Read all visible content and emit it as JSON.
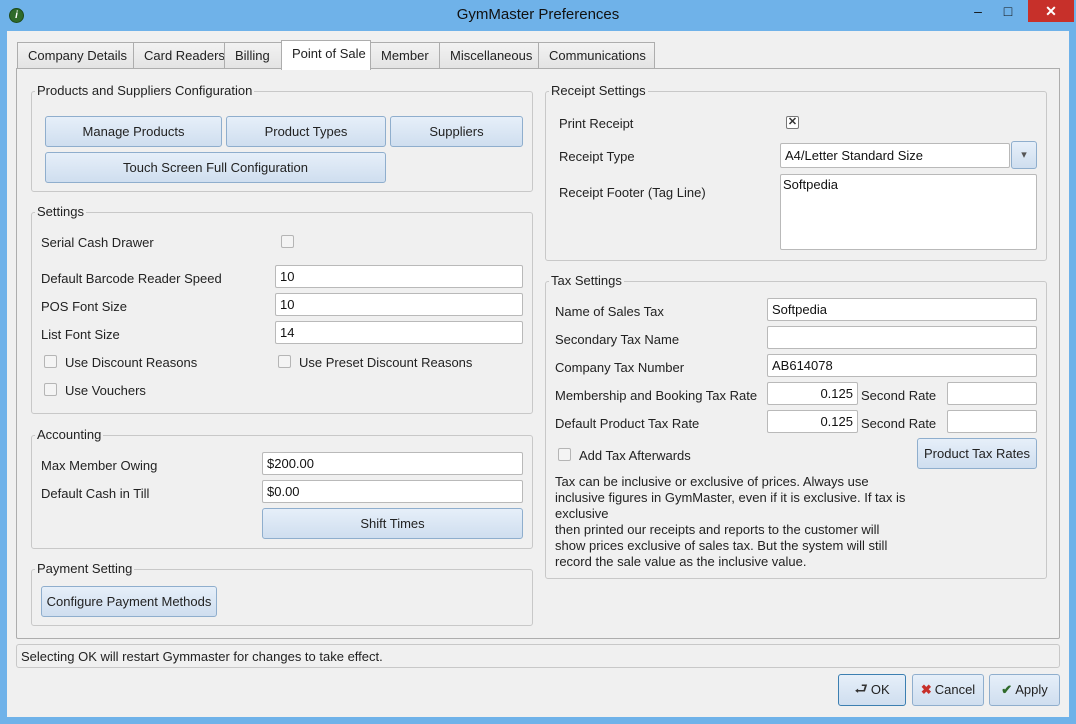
{
  "window": {
    "title": "GymMaster Preferences",
    "app_icon": "gymmaster-icon"
  },
  "window_controls": {
    "minimize": "–",
    "maximize": "□",
    "close": "✕"
  },
  "tabs": [
    {
      "label": "Company Details"
    },
    {
      "label": "Card Readers"
    },
    {
      "label": "Billing"
    },
    {
      "label": "Point of Sale"
    },
    {
      "label": "Member"
    },
    {
      "label": "Miscellaneous"
    },
    {
      "label": "Communications"
    }
  ],
  "active_tab": "Point of Sale",
  "products": {
    "legend": "Products and Suppliers Configuration",
    "manage_products": "Manage Products",
    "product_types": "Product Types",
    "suppliers": "Suppliers",
    "touch_screen": "Touch Screen Full Configuration"
  },
  "settings": {
    "legend": "Settings",
    "serial_cash_drawer": {
      "label": "Serial Cash Drawer",
      "checked": false
    },
    "barcode_speed": {
      "label": "Default Barcode Reader Speed",
      "value": "10"
    },
    "pos_font_size": {
      "label": "POS Font Size",
      "value": "10"
    },
    "list_font_size": {
      "label": "List Font Size",
      "value": "14"
    },
    "use_discount_reasons": {
      "label": "Use Discount Reasons",
      "checked": false
    },
    "use_preset_discount_reasons": {
      "label": "Use Preset Discount Reasons",
      "checked": false
    },
    "use_vouchers": {
      "label": "Use Vouchers",
      "checked": false
    }
  },
  "accounting": {
    "legend": "Accounting",
    "max_member_owing": {
      "label": "Max Member Owing",
      "value": "$200.00"
    },
    "default_cash": {
      "label": "Default Cash in Till",
      "value": "$0.00"
    },
    "shift_times": "Shift Times"
  },
  "payment": {
    "legend": "Payment Setting",
    "configure": "Configure Payment Methods"
  },
  "receipt": {
    "legend": "Receipt Settings",
    "print_receipt": {
      "label": "Print Receipt",
      "checked": true,
      "mark": "✕"
    },
    "receipt_type": {
      "label": "Receipt Type",
      "value": "A4/Letter Standard Size",
      "arrow": "▾"
    },
    "receipt_footer": {
      "label": "Receipt Footer (Tag Line)",
      "value": "Softpedia"
    }
  },
  "tax": {
    "legend": "Tax Settings",
    "sales_tax_name": {
      "label": "Name of Sales Tax",
      "value": "Softpedia"
    },
    "secondary_tax_name": {
      "label": "Secondary Tax Name",
      "value": ""
    },
    "company_tax_number": {
      "label": "Company Tax Number",
      "value": "AB614078"
    },
    "membership_rate": {
      "label": "Membership and Booking Tax Rate",
      "value": "0.125",
      "second_label": "Second Rate",
      "second_value": ""
    },
    "product_rate": {
      "label": "Default Product Tax Rate",
      "value": "0.125",
      "second_label": "Second Rate",
      "second_value": ""
    },
    "add_afterwards": {
      "label": "Add Tax Afterwards",
      "checked": false
    },
    "product_tax_rates": "Product Tax Rates",
    "note": [
      "Tax can be inclusive or exclusive of prices. Always use",
      "inclusive figures in GymMaster, even if it is exclusive. If tax is",
      "exclusive",
      "then printed our receipts and reports to the customer will",
      "show prices exclusive of sales tax. But the system will still",
      "record the sale value as the inclusive value."
    ]
  },
  "status_text": "Selecting OK will restart Gymmaster for changes to take effect.",
  "dialog_buttons": {
    "ok": "OK",
    "cancel": "Cancel",
    "apply": "Apply"
  },
  "colors": {
    "titlebar": "#6fb2e9",
    "close": "#c7302a",
    "button": "#d8e6f4"
  }
}
